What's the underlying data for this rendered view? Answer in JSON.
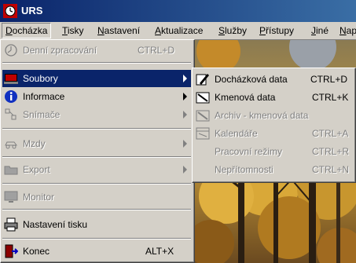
{
  "window": {
    "title": "URS"
  },
  "menubar": {
    "items": [
      {
        "label": "Docházka",
        "accel": "D"
      },
      {
        "label": "Tisky",
        "accel": "T"
      },
      {
        "label": "Nastavení",
        "accel": "N"
      },
      {
        "label": "Aktualizace",
        "accel": "A"
      },
      {
        "label": "Služby",
        "accel": "S"
      },
      {
        "label": "Přístupy",
        "accel": "P"
      },
      {
        "label": "Jiné",
        "accel": "J"
      },
      {
        "label": "Nap",
        "accel": "N"
      }
    ]
  },
  "main_menu": {
    "items": [
      {
        "label": "Denní zpracování",
        "shortcut": "CTRL+D",
        "icon": "clock-icon",
        "enabled": false
      },
      {
        "label": "Soubory",
        "icon": "laptop-icon",
        "enabled": true,
        "submenu": true,
        "selected": true
      },
      {
        "label": "Informace",
        "icon": "info-icon",
        "enabled": true,
        "submenu": true
      },
      {
        "label": "Snímače",
        "icon": "network-icon",
        "enabled": false,
        "submenu": true
      },
      {
        "label": "Mzdy",
        "icon": "car-icon",
        "enabled": false,
        "submenu": true
      },
      {
        "label": "Export",
        "icon": "folder-icon",
        "enabled": false,
        "submenu": true
      },
      {
        "label": "Monitor",
        "icon": "monitor-icon",
        "enabled": false
      },
      {
        "label": "Nastavení tisku",
        "icon": "printer-icon",
        "enabled": true
      },
      {
        "label": "Konec",
        "shortcut": "ALT+X",
        "icon": "exit-door-icon",
        "enabled": true
      }
    ]
  },
  "submenu": {
    "items": [
      {
        "label": "Docházková data",
        "shortcut": "CTRL+D",
        "icon": "edit-data-icon",
        "enabled": true
      },
      {
        "label": "Kmenová data",
        "shortcut": "CTRL+K",
        "icon": "master-data-icon",
        "enabled": true
      },
      {
        "label": "Archiv - kmenová data",
        "shortcut": "",
        "icon": "archive-icon",
        "enabled": false
      },
      {
        "label": "Kalendáře",
        "shortcut": "CTRL+A",
        "icon": "calendar-icon",
        "enabled": false
      },
      {
        "label": "Pracovní režimy",
        "shortcut": "CTRL+R",
        "icon": "",
        "enabled": false
      },
      {
        "label": "Nepřítomnosti",
        "shortcut": "CTRL+N",
        "icon": "",
        "enabled": false
      }
    ]
  },
  "colors": {
    "menu_face": "#d4d0c8",
    "selection": "#0a246a",
    "titlebar_start": "#0a246a",
    "titlebar_end": "#3a6ea5",
    "disabled_text": "#808080"
  }
}
